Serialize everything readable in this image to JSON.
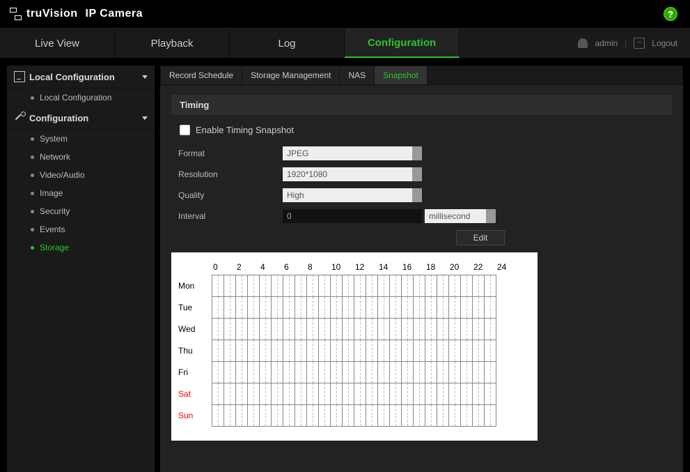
{
  "brand": {
    "part1": "tru",
    "part2": "Vision",
    "suffix": "IP Camera"
  },
  "help": "?",
  "nav": {
    "tabs": [
      "Live View",
      "Playback",
      "Log",
      "Configuration"
    ],
    "active_index": 3
  },
  "user": {
    "name": "admin",
    "logout": "Logout"
  },
  "sidebar": {
    "groups": [
      {
        "label": "Local Configuration",
        "items": [
          "Local Configuration"
        ],
        "active": -1
      },
      {
        "label": "Configuration",
        "items": [
          "System",
          "Network",
          "Video/Audio",
          "Image",
          "Security",
          "Events",
          "Storage"
        ],
        "active": 6
      }
    ]
  },
  "subtabs": {
    "items": [
      "Record Schedule",
      "Storage Management",
      "NAS",
      "Snapshot"
    ],
    "active_index": 3
  },
  "section": {
    "title": "Timing"
  },
  "form": {
    "enable_label": "Enable Timing Snapshot",
    "format_label": "Format",
    "format_value": "JPEG",
    "resolution_label": "Resolution",
    "resolution_value": "1920*1080",
    "quality_label": "Quality",
    "quality_value": "High",
    "interval_label": "Interval",
    "interval_value": "0",
    "interval_unit": "millisecond"
  },
  "edit_label": "Edit",
  "schedule": {
    "hours": [
      "0",
      "2",
      "4",
      "6",
      "8",
      "10",
      "12",
      "14",
      "16",
      "18",
      "20",
      "22",
      "24"
    ],
    "days": [
      "Mon",
      "Tue",
      "Wed",
      "Thu",
      "Fri",
      "Sat",
      "Sun"
    ]
  }
}
